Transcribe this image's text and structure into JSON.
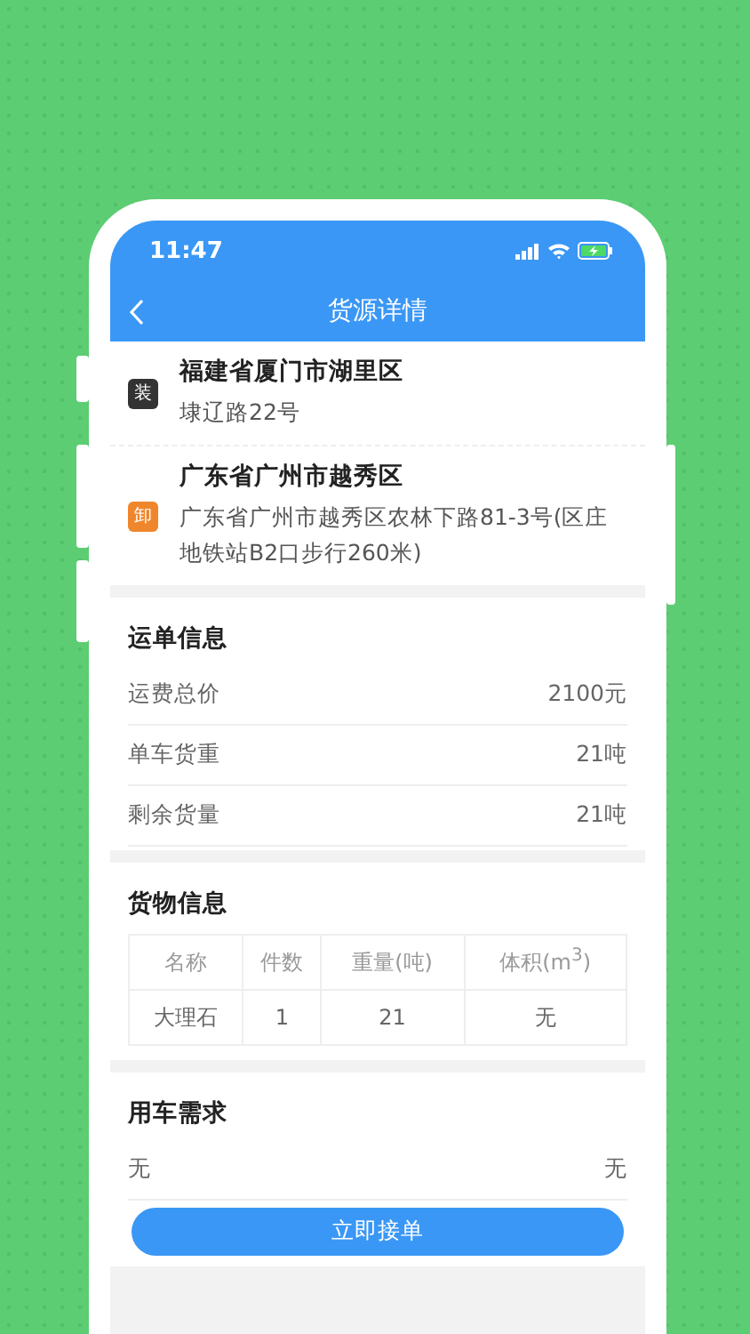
{
  "status_bar": {
    "time": "11:47"
  },
  "nav": {
    "title": "货源详情"
  },
  "addresses": [
    {
      "tag": "装",
      "color": "#333333",
      "city": "福建省厦门市湖里区",
      "detail": "埭辽路22号"
    },
    {
      "tag": "卸",
      "color": "#f0862c",
      "city": "广东省广州市越秀区",
      "detail": "广东省广州市越秀区农林下路81-3号(区庄地铁站B2口步行260米)"
    }
  ],
  "waybill": {
    "title": "运单信息",
    "rows": [
      {
        "label": "运费总价",
        "value": "2100元"
      },
      {
        "label": "单车货重",
        "value": "21吨"
      },
      {
        "label": "剩余货量",
        "value": "21吨"
      }
    ]
  },
  "cargo": {
    "title": "货物信息",
    "columns": [
      "名称",
      "件数",
      "重量(吨)",
      "体积(m$^{3}$)"
    ],
    "rows": [
      [
        "大理石",
        "1",
        "21",
        "无"
      ]
    ]
  },
  "vehicle": {
    "title": "用车需求",
    "rows": [
      {
        "label": "无",
        "value": "无"
      }
    ]
  },
  "action": {
    "label": "立即接单"
  }
}
